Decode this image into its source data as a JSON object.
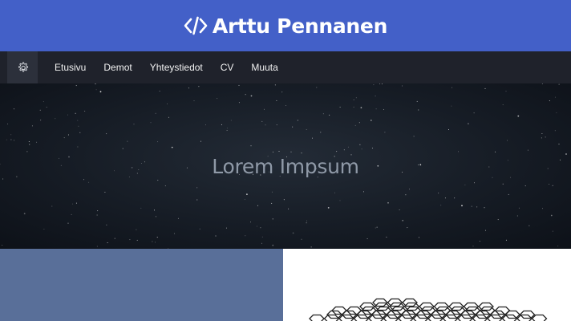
{
  "header": {
    "title": "Arttu Pennanen",
    "logo_icon": "code-icon",
    "background": "#4360c8"
  },
  "navbar": {
    "settings_icon": "gear-icon",
    "links": [
      "Etusivu",
      "Demot",
      "Yhteystiedot",
      "CV",
      "Muuta"
    ],
    "background": "#1f222b"
  },
  "hero": {
    "text": "Lorem Impsum",
    "background_image": "starry-night-sky"
  },
  "panels": {
    "left_color": "#596f99",
    "right_image": "hexagon-graphene-structure"
  }
}
